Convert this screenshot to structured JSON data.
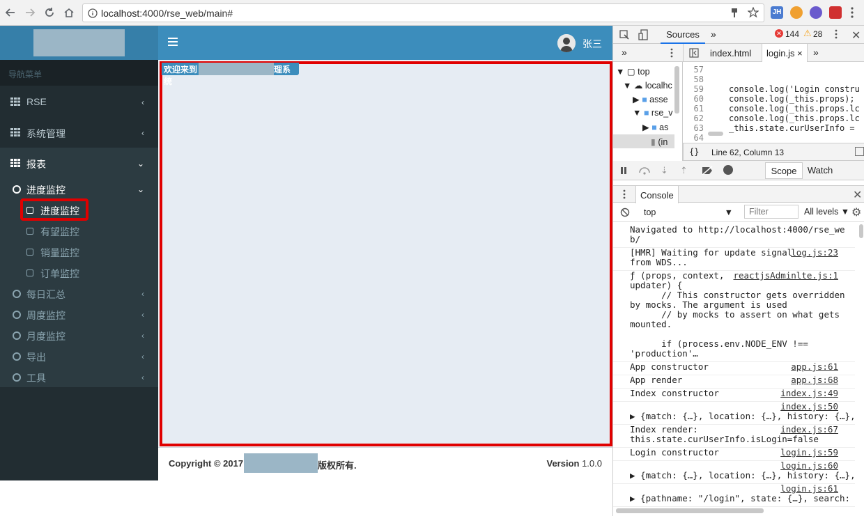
{
  "browser": {
    "url_host": "localhost",
    "url_rest": ":4000/rse_web/main#"
  },
  "header": {
    "username": "张三"
  },
  "sidebar": {
    "nav_header": "导航菜单",
    "items": [
      {
        "label": "RSE",
        "icon": "grid-icon"
      },
      {
        "label": "系统管理",
        "icon": "grid-icon"
      },
      {
        "label": "报表",
        "icon": "grid-icon"
      }
    ],
    "report_group": {
      "label": "进度监控"
    },
    "report_subitems": [
      {
        "label": "进度监控"
      },
      {
        "label": "有望监控"
      },
      {
        "label": "销量监控"
      },
      {
        "label": "订单监控"
      }
    ],
    "other_groups": [
      {
        "label": "每日汇总"
      },
      {
        "label": "周度监控"
      },
      {
        "label": "月度监控"
      },
      {
        "label": "导出"
      },
      {
        "label": "工具"
      }
    ]
  },
  "main": {
    "welcome_prefix": "欢迎来到",
    "welcome_suffix": "理系统"
  },
  "footer": {
    "copyright_prefix": "Copyright © 2017",
    "copyright_suffix": "版权所有.",
    "version_label": "Version",
    "version_number": "1.0.0"
  },
  "devtools": {
    "tab_sources": "Sources",
    "errors_count": "144",
    "warnings_count": "28",
    "file_tabs": [
      "index.html",
      "login.js"
    ],
    "tree": [
      "top",
      "localhc",
      "asse",
      "rse_v",
      "as",
      "(in"
    ],
    "line_numbers": [
      "57",
      "58",
      "59",
      "60",
      "61",
      "62",
      "63",
      "64"
    ],
    "code_lines": [
      "",
      "",
      "console.log('Login constru",
      "console.log(_this.props);",
      "console.log(_this.props.lc",
      "console.log(_this.props.lc",
      "_this.state.curUserInfo =",
      ""
    ],
    "cursor_position": "Line 62, Column 13",
    "scope_tab": "Scope",
    "watch_tab": "Watch",
    "console_tab": "Console",
    "context": "top",
    "filter_placeholder": "Filter",
    "levels": "All levels",
    "logs": [
      {
        "text": "Navigated to http://localhost:4000/rse_we\nb/",
        "src": ""
      },
      {
        "text": "[HMR] Waiting for update signal\nfrom WDS...",
        "src": "log.js:23"
      },
      {
        "text": "ƒ (props, context,\nupdater) {\n      // This constructor gets overridden\nby mocks. The argument is used\n      // by mocks to assert on what gets\nmounted.\n\n      if (process.env.NODE_ENV !==\n'production'…",
        "src": "reactjsAdminlte.js:1"
      },
      {
        "text": "App constructor",
        "src": "app.js:61"
      },
      {
        "text": "App render",
        "src": "app.js:68"
      },
      {
        "text": "Index constructor",
        "src": "index.js:49"
      },
      {
        "text": "\n▶ {match: {…}, location: {…}, history: {…}, st",
        "src": "index.js:50"
      },
      {
        "text": "Index render:\nthis.state.curUserInfo.isLogin=false",
        "src": "index.js:67"
      },
      {
        "text": "Login constructor",
        "src": "login.js:59"
      },
      {
        "text": "\n▶ {match: {…}, location: {…}, history: {…}, st",
        "src": "login.js:60"
      },
      {
        "text": "\n▶ {pathname: \"/login\", state: {…}, search: \"\",",
        "src": "login.js:61"
      }
    ]
  }
}
